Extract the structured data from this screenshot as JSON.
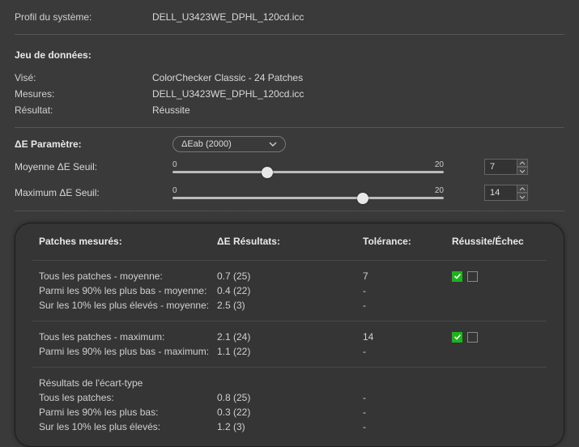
{
  "top": {
    "system_profile_label": "Profil du système:",
    "system_profile_value": "DELL_U3423WE_DPHL_120cd.icc"
  },
  "dataset": {
    "heading": "Jeu de données:",
    "target_label": "Visé:",
    "target_value": "ColorChecker Classic - 24 Patches",
    "measures_label": "Mesures:",
    "measures_value": "DELL_U3423WE_DPHL_120cd.icc",
    "result_label": "Résultat:",
    "result_value": "Réussite"
  },
  "de_param": {
    "label": "ΔE Paramètre:",
    "selected": "ΔEab (2000)"
  },
  "avg_threshold": {
    "label": "Moyenne ΔE Seuil:",
    "min": "0",
    "max": "20",
    "value": "7",
    "percent": 35
  },
  "max_threshold": {
    "label": "Maximum ΔE Seuil:",
    "min": "0",
    "max": "20",
    "value": "14",
    "percent": 70
  },
  "results": {
    "headers": {
      "col1": "Patches mesurés:",
      "col2": "ΔE Résultats:",
      "col3": "Tolérance:",
      "col4": "Réussite/Échec"
    },
    "group_avg": {
      "r1_label": "Tous les patches - moyenne:",
      "r1_val": "0.7 (25)",
      "r1_tol": "7",
      "r2_label": "Parmi les 90% les plus bas - moyenne:",
      "r2_val": "0.4 (22)",
      "r2_tol": "-",
      "r3_label": "Sur les 10% les plus élevés - moyenne:",
      "r3_val": "2.5 (3)",
      "r3_tol": "-"
    },
    "group_max": {
      "r1_label": "Tous les patches - maximum:",
      "r1_val": "2.1 (24)",
      "r1_tol": "14",
      "r2_label": "Parmi les 90% les plus bas - maximum:",
      "r2_val": "1.1 (22)",
      "r2_tol": "-"
    },
    "group_std": {
      "heading": "Résultats de l'écart-type",
      "r1_label": "Tous les patches:",
      "r1_val": "0.8 (25)",
      "r1_tol": "-",
      "r2_label": "Parmi les 90% les plus bas:",
      "r2_val": "0.3 (22)",
      "r2_tol": "-",
      "r3_label": "Sur les 10% les plus élevés:",
      "r3_val": "1.2 (3)",
      "r3_tol": "-"
    }
  }
}
